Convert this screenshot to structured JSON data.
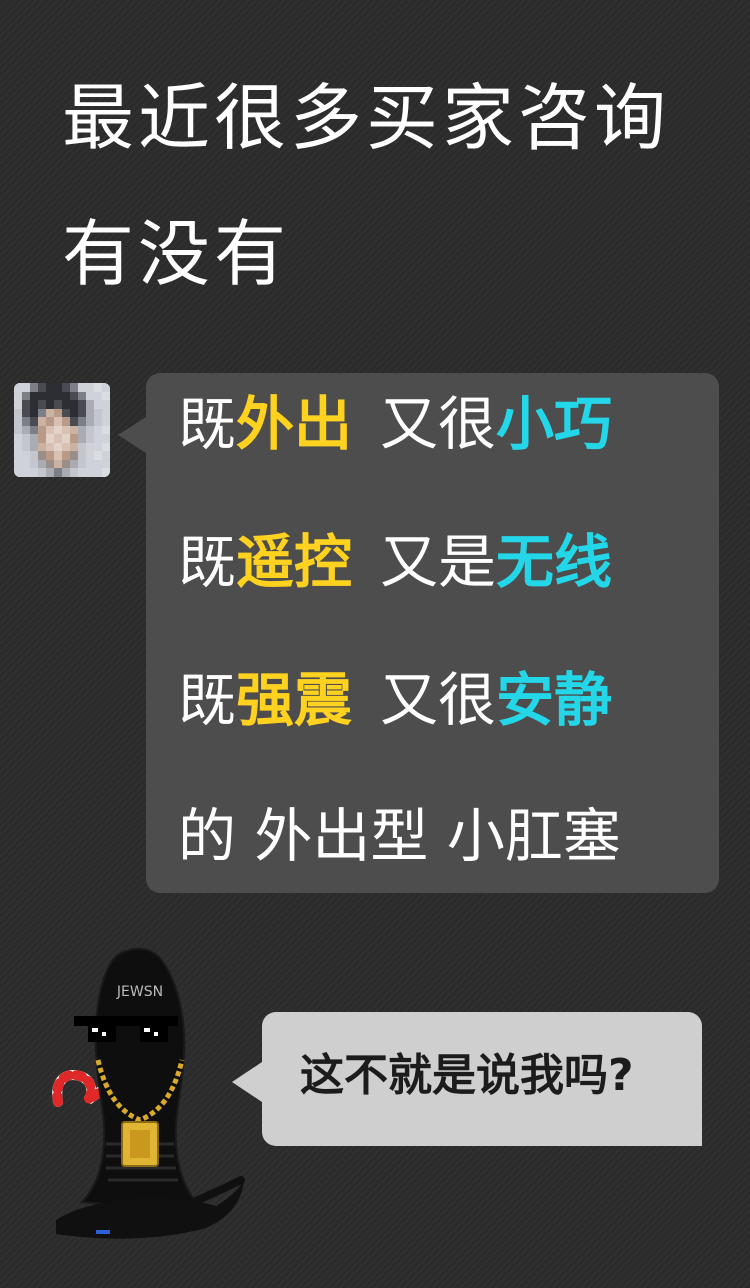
{
  "headline": {
    "line1": "最近很多买家咨询",
    "line2": "有没有"
  },
  "main_bubble": {
    "lines": [
      [
        {
          "text": "既",
          "style": "plain"
        },
        {
          "text": "外出",
          "style": "yellow"
        },
        {
          "text": "又很",
          "style": "plain"
        },
        {
          "text": "小巧",
          "style": "cyan"
        }
      ],
      [
        {
          "text": "既",
          "style": "plain"
        },
        {
          "text": "遥控",
          "style": "yellow"
        },
        {
          "text": "又是",
          "style": "plain"
        },
        {
          "text": "无线",
          "style": "cyan"
        }
      ],
      [
        {
          "text": "既",
          "style": "plain"
        },
        {
          "text": "强震",
          "style": "yellow"
        },
        {
          "text": "又很",
          "style": "plain"
        },
        {
          "text": "安静",
          "style": "cyan"
        }
      ],
      [
        {
          "text": "的 外出型 小肛塞",
          "style": "plain"
        }
      ]
    ]
  },
  "reply_bubble": {
    "text": "这不就是说我吗?"
  },
  "product_figure": {
    "brand_text": "JEWSN"
  },
  "colors": {
    "background": "#2b2b2b",
    "bubble": "#4d4d4d",
    "reply_bubble": "#cfcfcf",
    "yellow": "#ffd21f",
    "cyan": "#23d6e8"
  },
  "icons": {
    "avatar": "pixelated-avatar",
    "figure": "product-mascot-illustration"
  }
}
